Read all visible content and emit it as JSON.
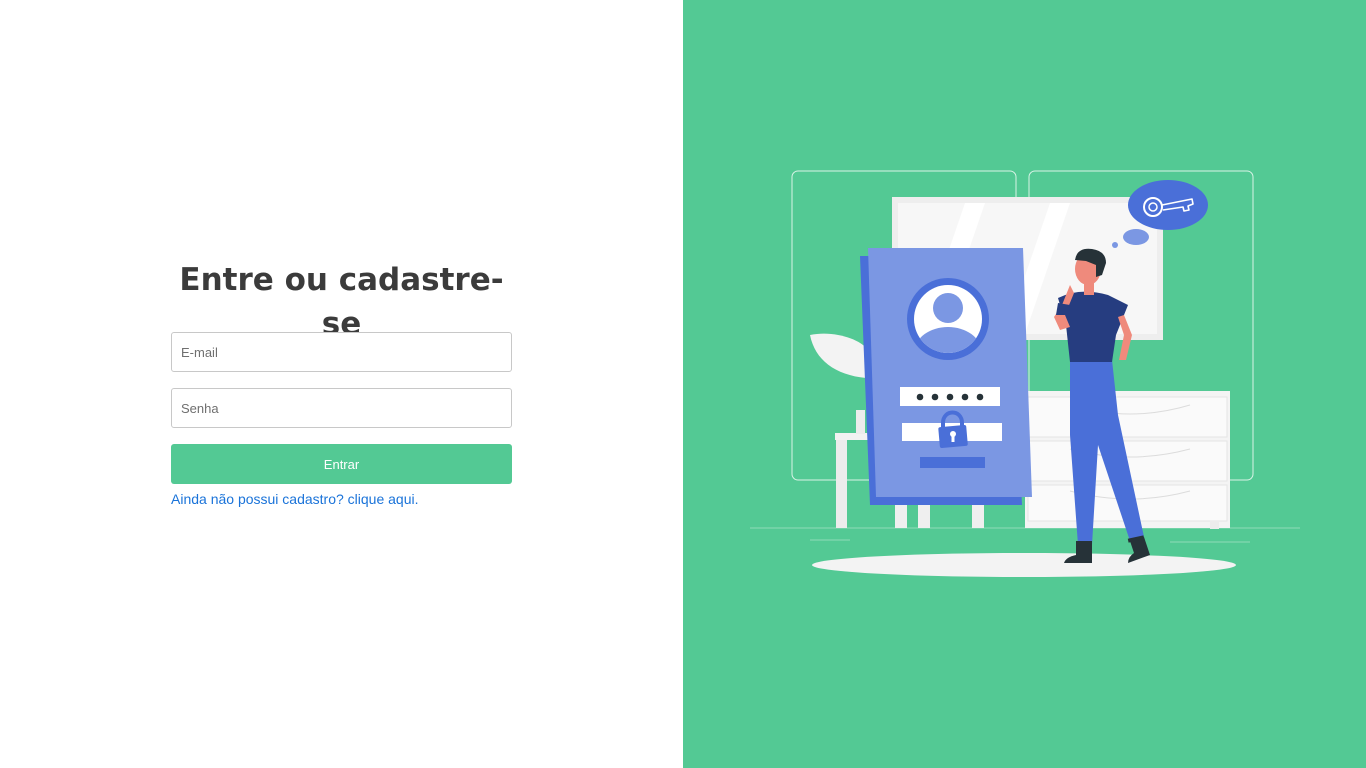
{
  "login": {
    "title": "Entre ou cadastre-se",
    "email_placeholder": "E-mail",
    "password_placeholder": "Senha",
    "submit_label": "Entrar",
    "register_link": "Ainda não possui cadastro? clique aqui."
  },
  "colors": {
    "accent": "#53c994",
    "link": "#1a73d9",
    "illustration_blue": "#4a6fd8",
    "illustration_light_blue": "#7b97e3"
  },
  "illustration": {
    "icons": [
      "key-icon",
      "user-avatar-icon",
      "padlock-icon"
    ]
  }
}
